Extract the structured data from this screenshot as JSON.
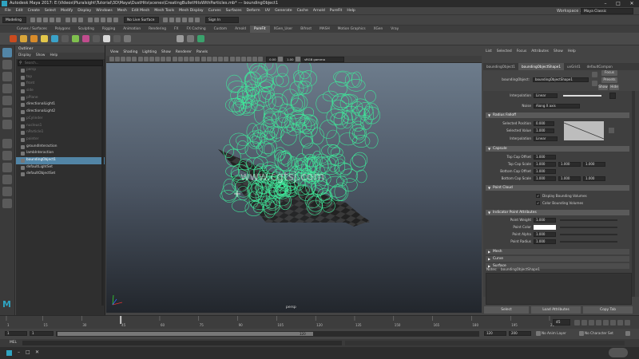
{
  "title_bar": {
    "app_title": "Autodesk Maya 2017: E:\\Videos\\Pluralsight\\Tutorial\\3D\\Maya\\DustHits\\scenes\\CreatingBulletHitsWithParticles.mb*  ---  boundingObject1"
  },
  "menu_bar": {
    "items": [
      "File",
      "Edit",
      "Create",
      "Select",
      "Modify",
      "Display",
      "Windows",
      "Mesh",
      "Edit Mesh",
      "Mesh Tools",
      "Mesh Display",
      "Curves",
      "Surfaces",
      "Deform",
      "UV",
      "Generate",
      "Cache",
      "Arnold",
      "PureFit",
      "Help"
    ],
    "workspace_label": "Workspace :",
    "workspace_value": "Maya Classic"
  },
  "status_line": {
    "mode": "Modeling",
    "live_surface": "No Live Surface",
    "sign_in": "Sign In"
  },
  "shelf_tabs": [
    "Curves / Surfaces",
    "Polygons",
    "Sculpting",
    "Rigging",
    "Animation",
    "Rendering",
    "FX",
    "FX Caching",
    "Custom",
    "Arnold",
    "PureFit",
    "XGen_User",
    "Bifrost",
    "MASH",
    "Motion Graphics",
    "XGen",
    "Vray"
  ],
  "outliner": {
    "title": "Outliner",
    "menu": [
      "Display",
      "Show",
      "Help"
    ],
    "search_placeholder": "Search...",
    "items": [
      {
        "label": "persp",
        "dim": true
      },
      {
        "label": "top",
        "dim": true
      },
      {
        "label": "front",
        "dim": true
      },
      {
        "label": "side",
        "dim": true
      },
      {
        "label": "pPlane",
        "dim": true
      },
      {
        "label": "directionalLight1",
        "dim": false
      },
      {
        "label": "directionalLight2",
        "dim": false
      },
      {
        "label": "pCylinder",
        "dim": true
      },
      {
        "label": "nucleus1",
        "dim": true
      },
      {
        "label": "nParticle1",
        "dim": true
      },
      {
        "label": "pointer",
        "dim": true
      },
      {
        "label": "groundInteraction",
        "dim": false
      },
      {
        "label": "lambInteraction",
        "dim": false
      },
      {
        "label": "boundingObject1",
        "dim": false,
        "selected": true
      },
      {
        "label": "defaultLightSet",
        "dim": false
      },
      {
        "label": "defaultObjectSet",
        "dim": false
      }
    ]
  },
  "viewport": {
    "menu": [
      "View",
      "Shading",
      "Lighting",
      "Show",
      "Renderer",
      "Panels"
    ],
    "field1": "0.00",
    "field2": "1.00",
    "color_space": "sRGB gamma",
    "camera_label": "persp",
    "watermark": "www.cgtsj.com"
  },
  "attribute_editor": {
    "menu": [
      "List",
      "Selected",
      "Focus",
      "Attributes",
      "Show",
      "Help"
    ],
    "tabs": [
      "boundingObject1",
      "boundingObjectShape1",
      "uvGrid1",
      "defaultCompon"
    ],
    "active_tab": 1,
    "node_label": "boundingObject:",
    "node_value": "boundingObjectShape1",
    "focus_btn": "Focus",
    "presets_btn": "Presets",
    "show_btn": "Show",
    "hide_btn": "Hide",
    "interp_label_top": "Interpolation",
    "interp_value_top": "Linear",
    "noise_label": "Noise",
    "noise_value": "Along X axis",
    "sections": {
      "radius_falloff": "Radius Falloff",
      "capsule": "Capsule",
      "point_cloud": "Point Cloud",
      "indicator": "Indicator Point Attributes",
      "mesh": "Mesh",
      "curve": "Curve",
      "surface": "Surface"
    },
    "selected_position_label": "Selected Position",
    "selected_position": "0.000",
    "selected_value_label": "Selected Value",
    "selected_value": "1.000",
    "interp_label": "Interpolation",
    "interp_value": "Linear",
    "top_cap_offset_label": "Top Cap Offset",
    "top_cap_offset": "1.000",
    "top_cap_scale_label": "Top Cap Scale",
    "top_cap_scale": [
      "1.000",
      "1.000",
      "1.000"
    ],
    "bottom_cap_offset_label": "Bottom Cap Offset",
    "bottom_cap_offset": "1.000",
    "bottom_cap_scale_label": "Bottom Cap Scale",
    "bottom_cap_scale": [
      "1.000",
      "1.000",
      "1.000"
    ],
    "display_bounding_volumes": "Display Bounding Volumes",
    "color_bounding_volumes": "Color Bounding Volumes",
    "point_weight_label": "Point Weight",
    "point_weight": "1.000",
    "point_color_label": "Point Color",
    "point_alpha_label": "Point Alpha",
    "point_alpha": "1.000",
    "point_radius_label": "Point Radius",
    "point_radius": "1.000",
    "notes_label": "Notes:",
    "notes_value": "boundingObjectShape1",
    "select_btn": "Select",
    "load_attributes_btn": "Load Attributes",
    "copy_tab_btn": "Copy Tab"
  },
  "time_slider": {
    "current_frame": "45",
    "tick_labels": [
      "1",
      "15",
      "30",
      "45",
      "60",
      "75",
      "90",
      "105",
      "120",
      "135",
      "150",
      "165",
      "180",
      "195",
      "210"
    ]
  },
  "range_slider": {
    "start": "1",
    "playback_start": "1",
    "range_label": "120",
    "playback_end": "120",
    "end": "200",
    "anim_layer": "No Anim Layer",
    "char_set": "No Character Set"
  },
  "mel_bar": {
    "label": "MEL"
  },
  "colors": {
    "selection_blue": "#5285a6",
    "wire_green": "#3fe89a",
    "viewport_top": "#6d7c8c",
    "viewport_bottom": "#22262c"
  }
}
